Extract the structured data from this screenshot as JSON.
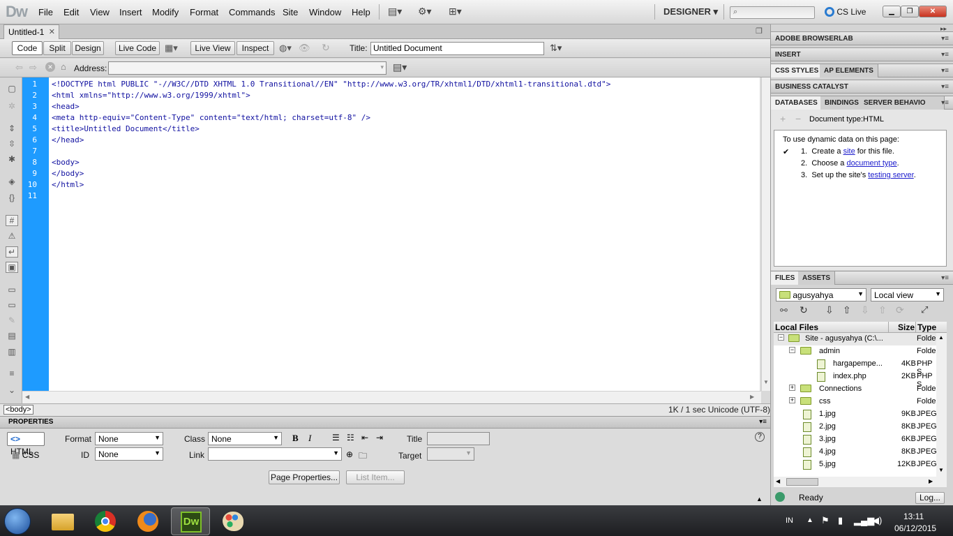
{
  "app": {
    "logo": "Dw",
    "workspace": "DESIGNER",
    "cs_live": "CS Live"
  },
  "menu": [
    "File",
    "Edit",
    "View",
    "Insert",
    "Modify",
    "Format",
    "Commands",
    "Site",
    "Window",
    "Help"
  ],
  "document": {
    "tab": "Untitled-1",
    "toolbar": {
      "code": "Code",
      "split": "Split",
      "design": "Design",
      "live_code": "Live Code",
      "live_view": "Live View",
      "inspect": "Inspect",
      "title_label": "Title:",
      "title_value": "Untitled Document"
    },
    "address_label": "Address:",
    "line_numbers": [
      "1",
      "2",
      "3",
      "4",
      "5",
      "6",
      "7",
      "8",
      "9",
      "10",
      "11"
    ],
    "code_lines": [
      "<!DOCTYPE html PUBLIC \"-//W3C//DTD XHTML 1.0 Transitional//EN\" \"http://www.w3.org/TR/xhtml1/DTD/xhtml1-transitional.dtd\">",
      "<html xmlns=\"http://www.w3.org/1999/xhtml\">",
      "<head>",
      "<meta http-equiv=\"Content-Type\" content=\"text/html; charset=utf-8\" />",
      "<title>Untitled Document</title>",
      "</head>",
      "",
      "<body>",
      "</body>",
      "</html>",
      ""
    ],
    "tag_selector": "<body>",
    "status_right": "1K / 1 sec  Unicode (UTF-8)"
  },
  "properties": {
    "title": "PROPERTIES",
    "html_btn": "HTML",
    "css_btn": "CSS",
    "format_label": "Format",
    "format_value": "None",
    "id_label": "ID",
    "id_value": "None",
    "class_label": "Class",
    "class_value": "None",
    "link_label": "Link",
    "title_label": "Title",
    "target_label": "Target",
    "page_properties": "Page Properties...",
    "list_item": "List Item..."
  },
  "panels": {
    "browserlab": "ADOBE BROWSERLAB",
    "insert": "INSERT",
    "css_styles": "CSS STYLES",
    "ap_elements": "AP ELEMENTS",
    "business_catalyst": "BUSINESS CATALYST",
    "databases": "DATABASES",
    "bindings": "BINDINGS",
    "server_behaviors": "SERVER BEHAVIO",
    "doc_type": "Document type:HTML",
    "dynamic_intro": "To use dynamic data on this page:",
    "steps": [
      {
        "num": "1.",
        "pre": "Create a ",
        "link": "site",
        "post": " for this file."
      },
      {
        "num": "2.",
        "pre": "Choose a ",
        "link": "document type",
        "post": "."
      },
      {
        "num": "3.",
        "pre": "Set up the site's ",
        "link": "testing server",
        "post": "."
      }
    ],
    "files": "FILES",
    "assets": "ASSETS",
    "site_select": "agusyahya",
    "view_select": "Local view",
    "col_local": "Local Files",
    "col_size": "Size",
    "col_type": "Type",
    "tree": [
      {
        "name": "Site - agusyahya (C:\\...",
        "size": "",
        "type": "Folde",
        "kind": "root"
      },
      {
        "name": "admin",
        "size": "",
        "type": "Folde",
        "kind": "folder-open"
      },
      {
        "name": "hargapempe...",
        "size": "4KB",
        "type": "PHP S",
        "kind": "file"
      },
      {
        "name": "index.php",
        "size": "2KB",
        "type": "PHP S",
        "kind": "file"
      },
      {
        "name": "Connections",
        "size": "",
        "type": "Folde",
        "kind": "folder"
      },
      {
        "name": "css",
        "size": "",
        "type": "Folde",
        "kind": "folder"
      },
      {
        "name": "1.jpg",
        "size": "9KB",
        "type": "JPEG",
        "kind": "img"
      },
      {
        "name": "2.jpg",
        "size": "8KB",
        "type": "JPEG",
        "kind": "img"
      },
      {
        "name": "3.jpg",
        "size": "6KB",
        "type": "JPEG",
        "kind": "img"
      },
      {
        "name": "4.jpg",
        "size": "8KB",
        "type": "JPEG",
        "kind": "img"
      },
      {
        "name": "5.jpg",
        "size": "12KB",
        "type": "JPEG",
        "kind": "img"
      }
    ],
    "status": "Ready",
    "log_btn": "Log..."
  },
  "taskbar": {
    "lang": "IN",
    "time": "13:11",
    "date": "06/12/2015"
  },
  "colors": {
    "gutter": "#1e9bff",
    "code": "#1010a0",
    "link": "#1a1acc"
  }
}
